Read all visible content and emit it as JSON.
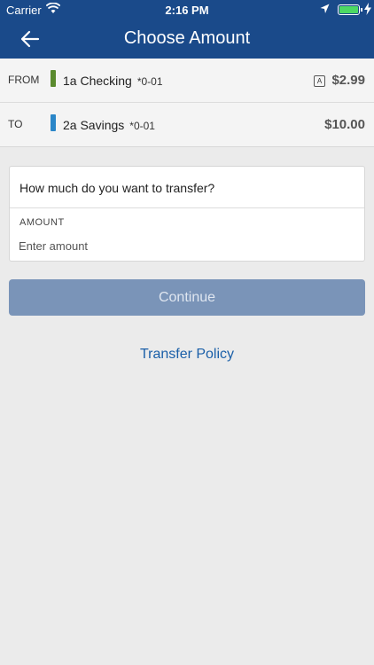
{
  "status_bar": {
    "carrier": "Carrier",
    "time": "2:16 PM"
  },
  "nav": {
    "title": "Choose Amount"
  },
  "accounts": {
    "from": {
      "direction": "FROM",
      "name": "1a Checking",
      "mask": "*0-01",
      "badge": "A",
      "amount": "$2.99",
      "color": "#5a8a2e"
    },
    "to": {
      "direction": "TO",
      "name": "2a Savings",
      "mask": "*0-01",
      "amount": "$10.00",
      "color": "#2a86c8"
    }
  },
  "form": {
    "question": "How much do you want to transfer?",
    "amount_label": "AMOUNT",
    "amount_placeholder": "Enter amount",
    "amount_value": ""
  },
  "buttons": {
    "continue": "Continue",
    "policy": "Transfer Policy"
  },
  "colors": {
    "brand": "#1a4a8a",
    "button_disabled": "#7a94b8",
    "link": "#1a5fa8"
  }
}
